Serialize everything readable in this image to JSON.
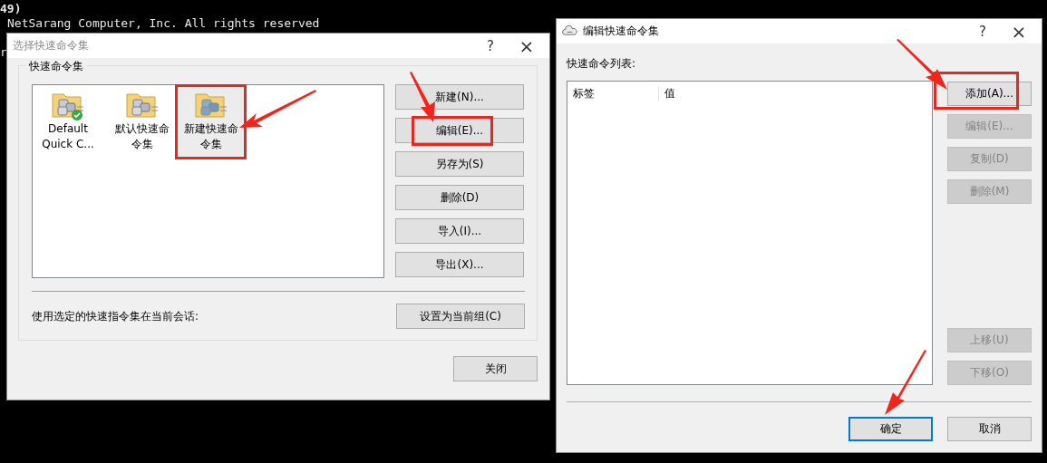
{
  "terminal": {
    "lines": [
      "49)",
      "NetSarang Computer, Inc. All rights reserved",
      "r"
    ]
  },
  "dialogs": [
    {
      "title": "选择快速命令集",
      "active": false,
      "help": "?",
      "close": "×",
      "group": {
        "label": "快速命令集",
        "items": [
          {
            "label": "Default Quick C...",
            "selected": false,
            "default": true,
            "highlighted": false
          },
          {
            "label": "默认快速命令集",
            "selected": false,
            "default": false,
            "highlighted": false
          },
          {
            "label": "新建快速命令集",
            "selected": true,
            "default": false,
            "highlighted": true
          }
        ],
        "buttons": [
          {
            "label": "新建(N)...",
            "disabled": false,
            "highlighted": false
          },
          {
            "label": "编辑(E)...",
            "disabled": false,
            "highlighted": true
          },
          {
            "label": "另存为(S)",
            "disabled": false,
            "highlighted": false
          },
          {
            "label": "删除(D)",
            "disabled": false,
            "highlighted": false
          },
          {
            "label": "导入(I)...",
            "disabled": false,
            "highlighted": false
          },
          {
            "label": "导出(X)...",
            "disabled": false,
            "highlighted": false
          }
        ],
        "hint": "使用选定的快速指令集在当前会话:",
        "apply_button": "设置为当前组(C)"
      },
      "close_button": "关闭"
    },
    {
      "title": "编辑快速命令集",
      "active": true,
      "help": "?",
      "close": "×",
      "list_label": "快速命令列表:",
      "columns": [
        "标签",
        "值"
      ],
      "buttons": [
        {
          "label": "添加(A)...",
          "disabled": false,
          "highlighted": true
        },
        {
          "label": "编辑(E)...",
          "disabled": true,
          "highlighted": false
        },
        {
          "label": "复制(D)",
          "disabled": true,
          "highlighted": false
        },
        {
          "label": "删除(M)",
          "disabled": true,
          "highlighted": false
        }
      ],
      "move_buttons": [
        {
          "label": "上移(U)",
          "disabled": true
        },
        {
          "label": "下移(O)",
          "disabled": true
        }
      ],
      "footer_buttons": [
        {
          "label": "确定",
          "focused": true
        },
        {
          "label": "取消",
          "focused": false
        }
      ]
    }
  ]
}
